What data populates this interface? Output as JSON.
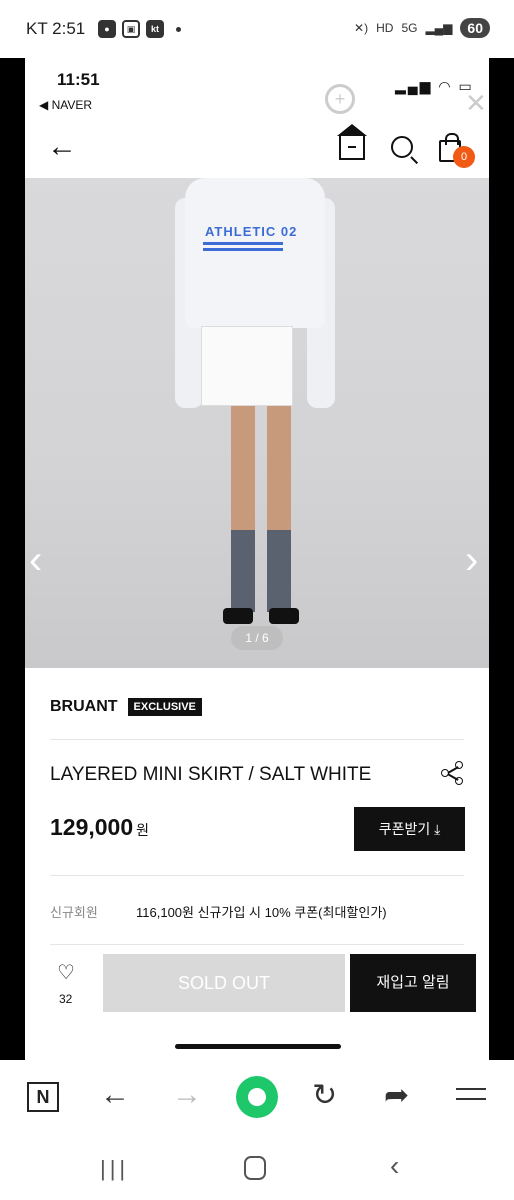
{
  "outer_status": {
    "carrier_time": "KT 2:51",
    "battery": "60"
  },
  "inner_status": {
    "time": "11:51",
    "back_app": "◀ NAVER"
  },
  "nav": {
    "cart_count": "0"
  },
  "gallery": {
    "counter": "1 / 6",
    "shirt_text": "ATHLETIC 02"
  },
  "product": {
    "brand": "BRUANT",
    "badge": "EXCLUSIVE",
    "title": "LAYERED MINI SKIRT / SALT WHITE",
    "price": "129,000",
    "currency": "원",
    "coupon_button": "쿠폰받기 ⤓",
    "member_label": "신규회원",
    "member_text": "116,100원 신규가입 시 10% 쿠폰(최대할인가)"
  },
  "bottom": {
    "like_count": "32",
    "soldout_label": "SOLD OUT",
    "restock_label": "재입고 알림"
  },
  "browser": {
    "n_label": "N"
  },
  "colors": {
    "cart_badge": "#f05a14",
    "browser_green": "#1ec76a",
    "stripe_blue": "#3c6dd6"
  }
}
